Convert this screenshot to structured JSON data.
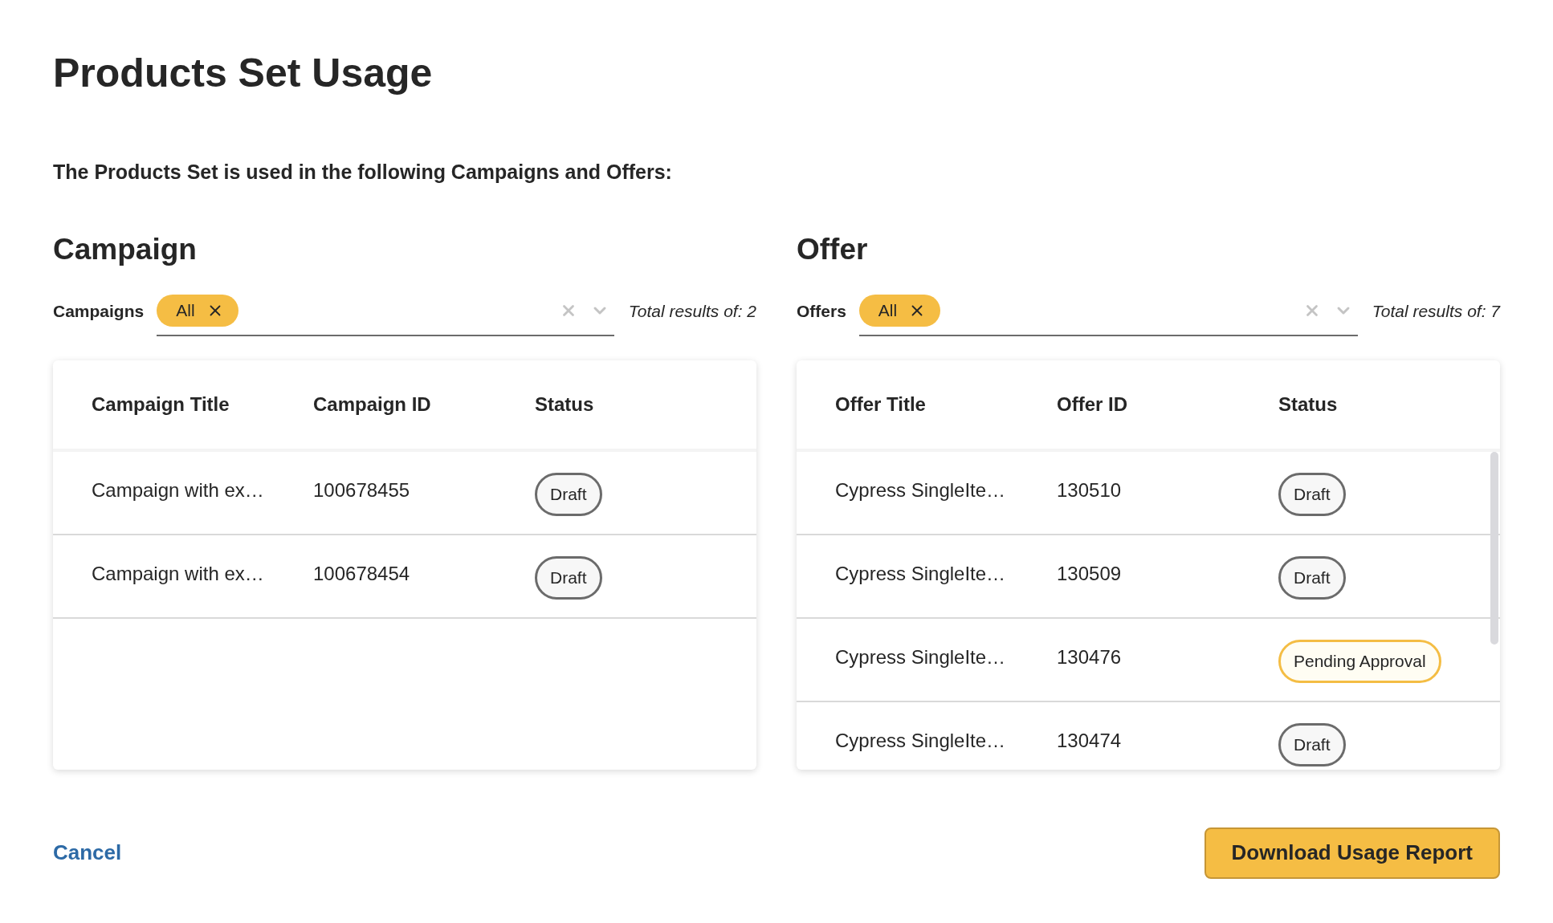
{
  "title": "Products Set Usage",
  "subtitle": "The Products Set is used in the following Campaigns and Offers:",
  "sections": [
    {
      "heading": "Campaign",
      "filter_label": "Campaigns",
      "chip": "All",
      "total": "Total results of: 2",
      "scrollbar": false,
      "columns": [
        "Campaign Title",
        "Campaign ID",
        "Status"
      ],
      "rows": [
        {
          "title": "Campaign with ex…",
          "id": "100678455",
          "status": {
            "label": "Draft",
            "kind": "draft"
          }
        },
        {
          "title": "Campaign with ex…",
          "id": "100678454",
          "status": {
            "label": "Draft",
            "kind": "draft"
          }
        }
      ]
    },
    {
      "heading": "Offer",
      "filter_label": "Offers",
      "chip": "All",
      "total": "Total results of: 7",
      "scrollbar": true,
      "columns": [
        "Offer Title",
        "Offer ID",
        "Status"
      ],
      "rows": [
        {
          "title": "Cypress SingleIte…",
          "id": "130510",
          "status": {
            "label": "Draft",
            "kind": "draft"
          }
        },
        {
          "title": "Cypress SingleIte…",
          "id": "130509",
          "status": {
            "label": "Draft",
            "kind": "draft"
          }
        },
        {
          "title": "Cypress SingleIte…",
          "id": "130476",
          "status": {
            "label": "Pending Approval",
            "kind": "pending"
          }
        },
        {
          "title": "Cypress SingleIte…",
          "id": "130474",
          "status": {
            "label": "Draft",
            "kind": "draft"
          }
        }
      ]
    }
  ],
  "cancel": "Cancel",
  "download": "Download Usage Report"
}
